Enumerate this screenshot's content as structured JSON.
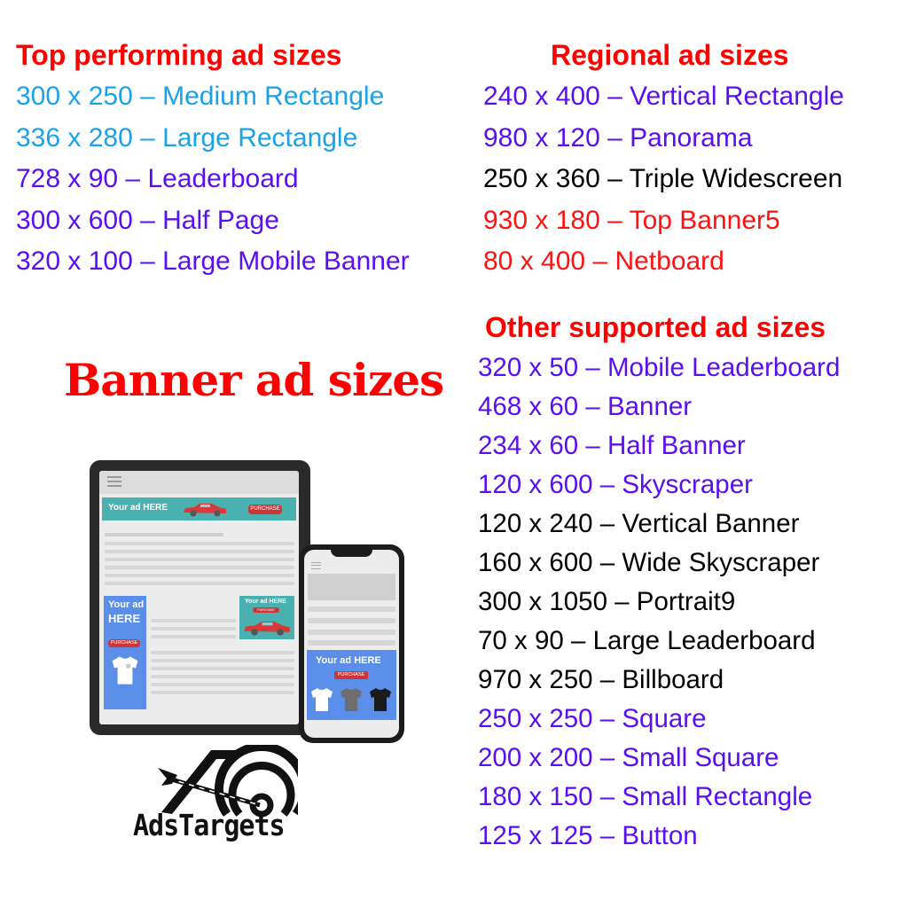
{
  "sections": {
    "top": {
      "title": "Top performing ad sizes",
      "items": [
        {
          "text": "300 x 250 – Medium Rectangle",
          "color": "blue"
        },
        {
          "text": "336 x 280 – Large Rectangle",
          "color": "blue"
        },
        {
          "text": "728 x 90 – Leaderboard",
          "color": "purple"
        },
        {
          "text": "300 x 600 – Half Page",
          "color": "purple"
        },
        {
          "text": "320 x 100 – Large Mobile Banner",
          "color": "purple"
        }
      ]
    },
    "regional": {
      "title": "Regional ad sizes",
      "items": [
        {
          "text": "240 x 400 – Vertical Rectangle",
          "color": "purple"
        },
        {
          "text": "980 x 120 – Panorama",
          "color": "purple"
        },
        {
          "text": "250 x 360 – Triple Widescreen",
          "color": "black"
        },
        {
          "text": "930 x 180 – Top Banner5",
          "color": "red"
        },
        {
          "text": "80 x 400 – Netboard",
          "color": "red"
        }
      ]
    },
    "other": {
      "title": "Other supported ad sizes",
      "items": [
        {
          "text": "320 x 50 – Mobile Leaderboard",
          "color": "purple"
        },
        {
          "text": "468 x 60 – Banner",
          "color": "purple"
        },
        {
          "text": "234 x 60 – Half Banner",
          "color": "purple"
        },
        {
          "text": "120 x 600 – Skyscraper",
          "color": "purple"
        },
        {
          "text": "120 x 240 – Vertical Banner",
          "color": "black"
        },
        {
          "text": "160 x 600 – Wide Skyscraper",
          "color": "black"
        },
        {
          "text": "300 x 1050 – Portrait9",
          "color": "black"
        },
        {
          "text": "70 x 90 – Large Leaderboard",
          "color": "black"
        },
        {
          "text": "970 x 250 – Billboard",
          "color": "black"
        },
        {
          "text": "250 x 250 – Square",
          "color": "purple"
        },
        {
          "text": "200 x 200 – Small Square",
          "color": "purple"
        },
        {
          "text": "180 x 150 – Small Rectangle",
          "color": "purple"
        },
        {
          "text": "125 x 125 – Button",
          "color": "purple"
        }
      ]
    }
  },
  "main_title": "Banner ad sizes",
  "illustration": {
    "ad_text_short": "Your ad HERE",
    "ad_text_line1": "Your ad",
    "ad_text_line2": "HERE",
    "purchase_label": "PURCHASE"
  },
  "logo": {
    "name": "AdsTargets"
  },
  "colors": {
    "heading_red": "#ff0000",
    "blue": "#1ba1e8",
    "purple": "#5a0ff0",
    "black": "#000000",
    "red": "#ff1111",
    "teal_ad": "#4ab0b0",
    "blue_ad": "#5b8ee8"
  }
}
